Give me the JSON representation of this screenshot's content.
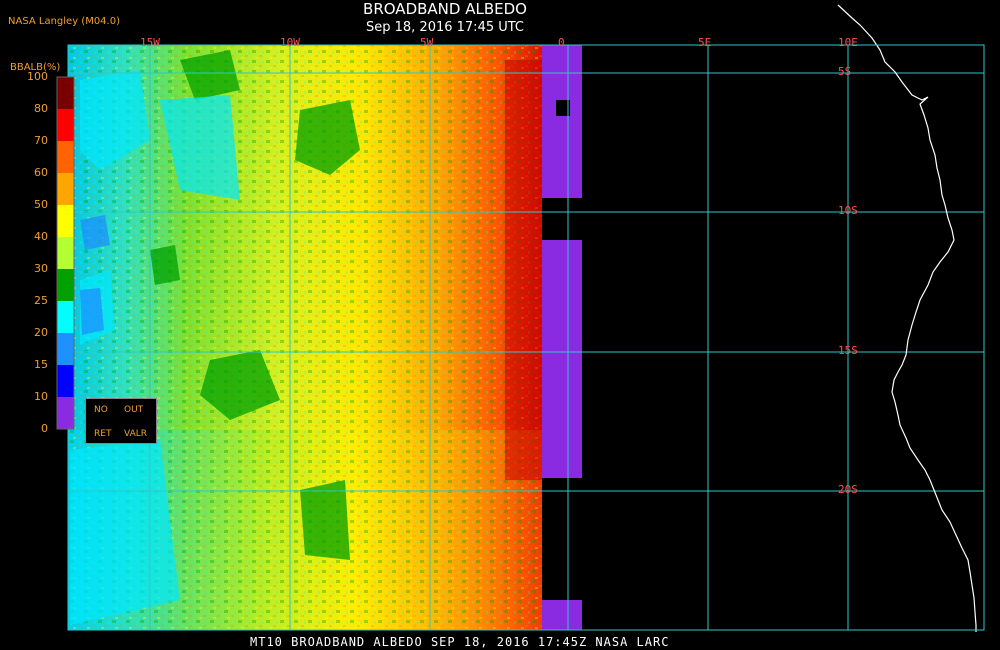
{
  "header": {
    "credit": "NASA Langley (M04.0)",
    "title": "BROADBAND ALBEDO",
    "subtitle": "Sep 18, 2016 17:45 UTC"
  },
  "footer": {
    "text": "MT10  BROADBAND ALBEDO  SEP 18, 2016 17:45Z  NASA LARC"
  },
  "colorbar": {
    "units_label": "BBALB(%)",
    "ticks": [
      "100",
      "80",
      "70",
      "60",
      "50",
      "40",
      "30",
      "25",
      "20",
      "15",
      "10",
      "0"
    ],
    "bins": [
      {
        "value": 100,
        "color": "#7a0000"
      },
      {
        "value": 80,
        "color": "#ff0000"
      },
      {
        "value": 70,
        "color": "#ff6400"
      },
      {
        "value": 60,
        "color": "#ffa500"
      },
      {
        "value": 50,
        "color": "#ffff00"
      },
      {
        "value": 40,
        "color": "#b4ff32"
      },
      {
        "value": 30,
        "color": "#00a000"
      },
      {
        "value": 25,
        "color": "#00ffff"
      },
      {
        "value": 20,
        "color": "#1e90ff"
      },
      {
        "value": 15,
        "color": "#0000ff"
      },
      {
        "value": 10,
        "color": "#8a2be2"
      }
    ],
    "nodata_labels": [
      "NO",
      "OUT",
      "RET",
      "VALR"
    ]
  },
  "grid": {
    "longitude_labels": [
      "15W",
      "10W",
      "5W",
      "0",
      "5E",
      "10E"
    ],
    "latitude_labels": [
      "5S",
      "10S",
      "15S",
      "20S"
    ]
  },
  "colors": {
    "grid": "#2fc8c8",
    "coast": "#ffffff",
    "grid_label": "#ff5050",
    "annotation": "#f0a030",
    "nodata": "#8a2be2",
    "background": "#000000"
  }
}
